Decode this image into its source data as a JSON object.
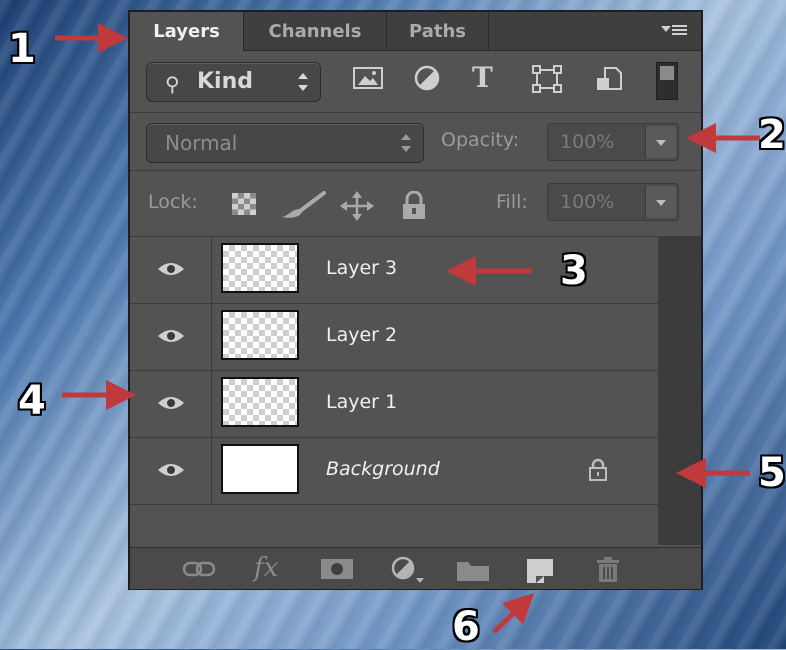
{
  "tabs": [
    {
      "label": "Layers",
      "active": true
    },
    {
      "label": "Channels",
      "active": false
    },
    {
      "label": "Paths",
      "active": false
    }
  ],
  "filter": {
    "kind_label": "Kind",
    "icons": [
      "image-filter-icon",
      "adjustment-filter-icon",
      "type-filter-icon",
      "shape-filter-icon",
      "smart-object-filter-icon"
    ],
    "type_glyph": "T"
  },
  "blend": {
    "mode": "Normal",
    "opacity_label": "Opacity:",
    "opacity_value": "100%"
  },
  "lock": {
    "label": "Lock:",
    "fill_label": "Fill:",
    "fill_value": "100%"
  },
  "layers": [
    {
      "name": "Layer 3",
      "visible": true,
      "thumb": "transparent",
      "locked": false
    },
    {
      "name": "Layer 2",
      "visible": true,
      "thumb": "transparent",
      "locked": false
    },
    {
      "name": "Layer 1",
      "visible": true,
      "thumb": "transparent",
      "locked": false
    },
    {
      "name": "Background",
      "visible": true,
      "thumb": "white",
      "locked": true,
      "italic": true
    }
  ],
  "footer": {
    "fx_label": "fx",
    "icons": [
      "link-layers-icon",
      "layer-style-icon",
      "add-mask-icon",
      "adjustment-layer-icon",
      "new-group-icon",
      "new-layer-icon",
      "delete-layer-icon"
    ]
  },
  "annotations": [
    "1",
    "2",
    "3",
    "4",
    "5",
    "6"
  ],
  "colors": {
    "panel": "#535353",
    "arrow": "#c0393b",
    "text": "#f0f0f0"
  }
}
